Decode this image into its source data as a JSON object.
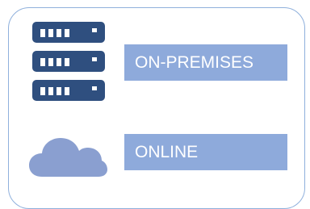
{
  "labels": {
    "on_premises": "ON-PREMISES",
    "online": "ONLINE"
  },
  "icons": {
    "server": "server-stack-icon",
    "cloud": "cloud-icon"
  },
  "colors": {
    "server_icon": "#2f4f7f",
    "cloud_icon": "#8a9fd0",
    "label_fill": "#8eaadb",
    "label_text": "#ffffff",
    "frame_border": "#8fb0dc"
  }
}
